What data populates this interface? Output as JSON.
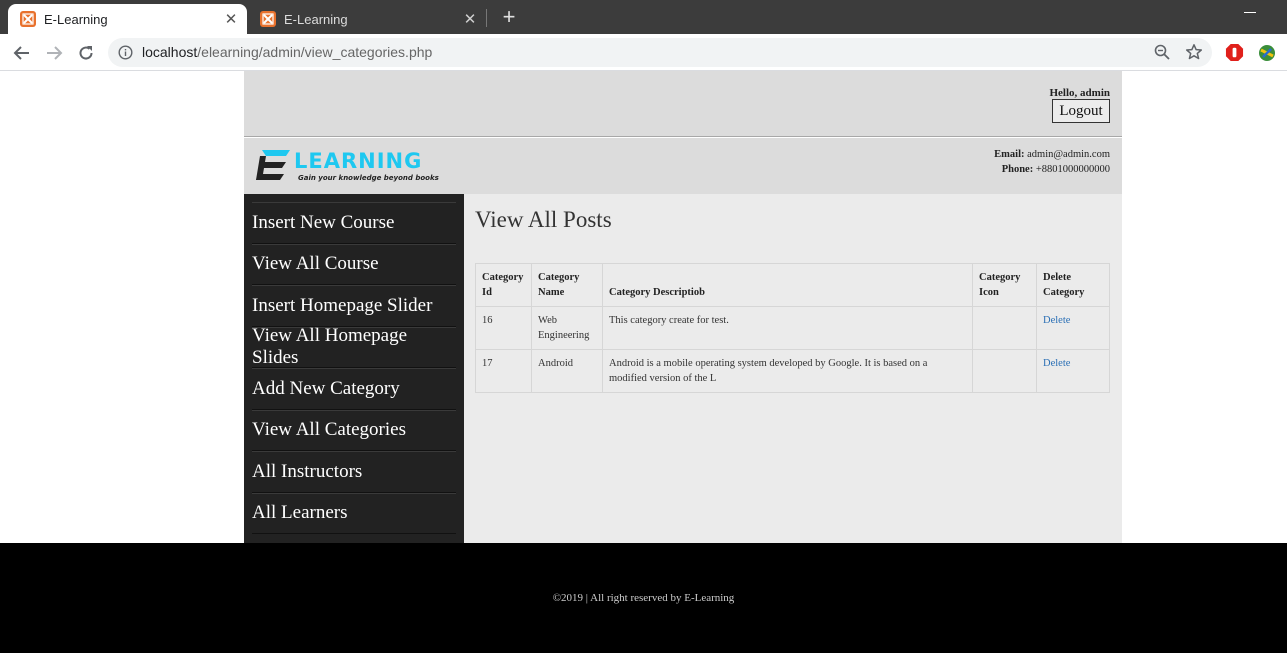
{
  "browser": {
    "tabs": [
      {
        "title": "E-Learning",
        "active": true
      },
      {
        "title": "E-Learning",
        "active": false
      }
    ],
    "url_host": "localhost",
    "url_path": "/elearning/admin/view_categories.php"
  },
  "topbar": {
    "greeting": "Hello, admin",
    "logout_label": "Logout"
  },
  "header": {
    "logo_text": "LEARNING",
    "logo_tagline": "Gain your knowledge beyond books",
    "email_label": "Email:",
    "email": "admin@admin.com",
    "phone_label": "Phone:",
    "phone": "+8801000000000"
  },
  "sidebar": {
    "items": [
      {
        "label": "Insert New Course"
      },
      {
        "label": "View All Course"
      },
      {
        "label": "Insert Homepage Slider"
      },
      {
        "label": "View All Homepage Slides"
      },
      {
        "label": "Add New Category"
      },
      {
        "label": "View All Categories"
      },
      {
        "label": "All Instructors"
      },
      {
        "label": "All Learners"
      }
    ]
  },
  "main": {
    "title": "View All Posts",
    "table": {
      "headers": [
        "Category Id",
        "Category Name",
        "Category Descriptiob",
        "Category Icon",
        "Delete Category"
      ],
      "rows": [
        {
          "id": "16",
          "name": "Web Engineering",
          "description": "This category create for test.",
          "icon": "",
          "action": "Delete"
        },
        {
          "id": "17",
          "name": "Android",
          "description": "Android is a mobile operating system developed by Google. It is based on a modified version of the L",
          "icon": "",
          "action": "Delete"
        }
      ]
    }
  },
  "footer": {
    "text": "©2019 | All right reserved by E-Learning"
  },
  "colors": {
    "logo_blue": "#1ec8f0",
    "sidebar_bg": "#222222",
    "favicon": "#e8712d"
  }
}
